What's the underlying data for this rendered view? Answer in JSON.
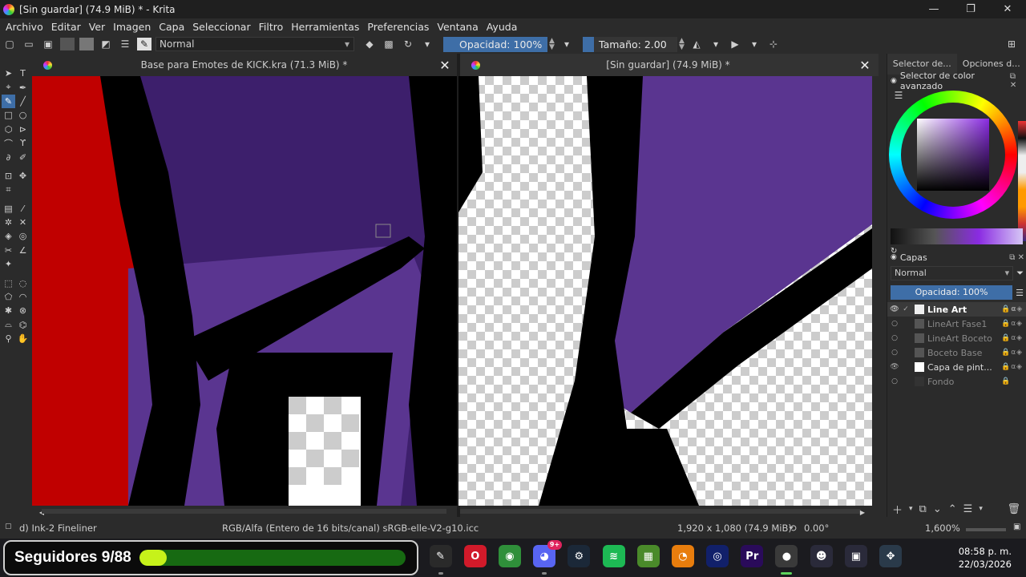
{
  "window": {
    "title": "[Sin guardar]  (74.9 MiB) * - Krita",
    "controls": [
      "—",
      "❐",
      "✕"
    ]
  },
  "menu": [
    "Archivo",
    "Editar",
    "Ver",
    "Imagen",
    "Capa",
    "Seleccionar",
    "Filtro",
    "Herramientas",
    "Preferencias",
    "Ventana",
    "Ayuda"
  ],
  "toolbar": {
    "blend_mode": "Normal",
    "opacity": "Opacidad: 100%",
    "size": "Tamaño: 2.00 px"
  },
  "tabs": [
    {
      "title": "Base para Emotes de KICK.kra (71.3 MiB) *",
      "close": "✕"
    },
    {
      "title": "[Sin guardar]  (74.9 MiB) *",
      "close": "✕"
    }
  ],
  "right_dock": {
    "tabs": [
      "Selector de...",
      "Opciones d..."
    ],
    "color_panel_title": "Selector de color avanzado",
    "layers_title": "Capas",
    "layers_blend": "Normal",
    "layers_opacity": "Opacidad:  100%",
    "layers": [
      {
        "name": "Line Art",
        "visible": true,
        "active": true
      },
      {
        "name": "LineArt Fase1",
        "visible": false,
        "active": false
      },
      {
        "name": "LineArt Boceto",
        "visible": false,
        "active": false
      },
      {
        "name": "Boceto Base",
        "visible": false,
        "active": false
      },
      {
        "name": "Capa de pint...",
        "visible": true,
        "active": false
      },
      {
        "name": "Fondo",
        "visible": false,
        "active": false
      }
    ]
  },
  "status": {
    "brush": "d) Ink-2 Fineliner",
    "color_space": "RGB/Alfa (Entero de 16 bits/canal)  sRGB-elle-V2-g10.icc",
    "dimensions": "1,920 x 1,080 (74.9 MiB)",
    "rotation": "0.00°",
    "zoom": "1,600%"
  },
  "overlay": {
    "label": "Seguidores 9/88",
    "progress_fraction": 0.1023
  },
  "taskbar": {
    "icons": [
      {
        "name": "pen-app-icon",
        "glyph": "✎",
        "color": "#2a2a2a"
      },
      {
        "name": "opera-icon",
        "glyph": "O",
        "color": "#d11a2a"
      },
      {
        "name": "chrome-icon",
        "glyph": "◉",
        "color": "#2f8f3a"
      },
      {
        "name": "discord-icon",
        "glyph": "◕",
        "color": "#5865f2"
      },
      {
        "name": "steam-icon",
        "glyph": "⚙",
        "color": "#1b2838"
      },
      {
        "name": "spotify-icon",
        "glyph": "≋",
        "color": "#1db954"
      },
      {
        "name": "minecraft-icon",
        "glyph": "▦",
        "color": "#4a8a2a"
      },
      {
        "name": "blender-icon",
        "glyph": "◔",
        "color": "#e87d0d"
      },
      {
        "name": "cinema4d-icon",
        "glyph": "◎",
        "color": "#11206a"
      },
      {
        "name": "premiere-icon",
        "glyph": "Pr",
        "color": "#2a0b5a"
      },
      {
        "name": "krita-icon",
        "glyph": "●",
        "color": "#3a3a3a"
      },
      {
        "name": "chat-app-icon",
        "glyph": "☻",
        "color": "#2a2a3a"
      },
      {
        "name": "store-icon",
        "glyph": "▣",
        "color": "#2a2a3a"
      },
      {
        "name": "game-launcher-icon",
        "glyph": "✥",
        "color": "#2a3a4a"
      }
    ],
    "discord_badge": "9+",
    "time": "08:58 p. m.",
    "date": "22/03/2026"
  }
}
